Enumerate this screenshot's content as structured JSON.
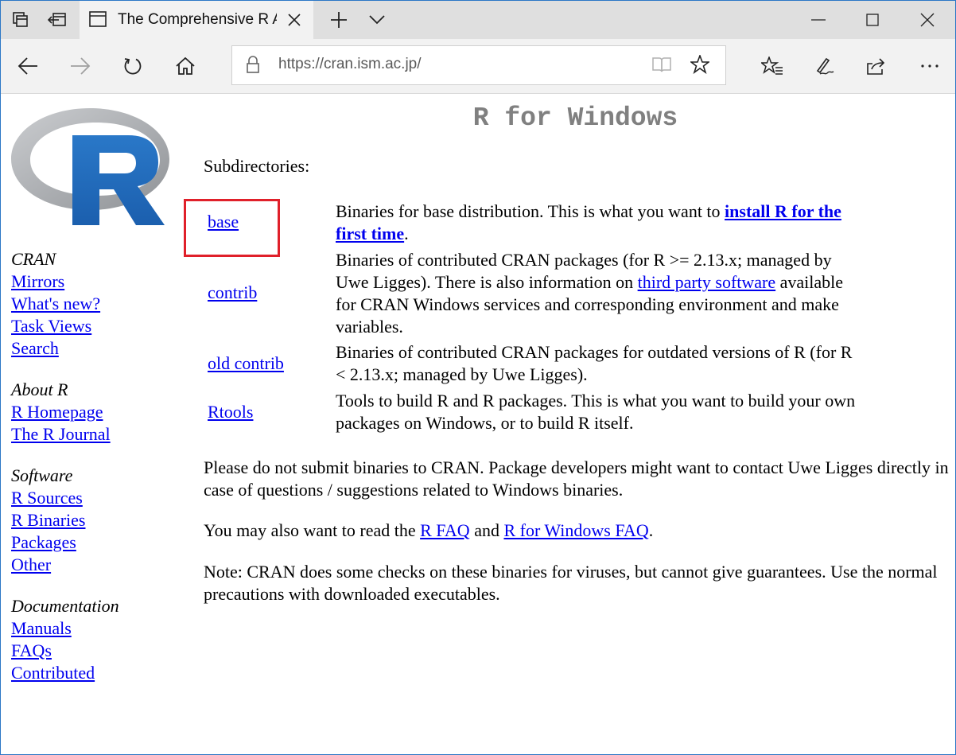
{
  "browser": {
    "tab_title": "The Comprehensive R A",
    "url": "https://cran.ism.ac.jp/",
    "icons": [
      "tab-manager-icon",
      "set-aside-tabs-icon",
      "page-icon",
      "close-icon",
      "new-tab-icon",
      "chevron-down-icon",
      "minimize-icon",
      "maximize-icon",
      "window-close-icon",
      "back-icon",
      "forward-icon",
      "refresh-icon",
      "home-icon",
      "lock-icon",
      "reading-view-icon",
      "favorite-star-icon",
      "favorites-hub-icon",
      "pen-icon",
      "share-icon",
      "more-icon"
    ]
  },
  "logo": {
    "colors": {
      "ring": "#a7a9ad",
      "letter": "#2067b8"
    }
  },
  "sidebar": {
    "groups": [
      {
        "heading": "CRAN",
        "links": [
          "Mirrors",
          "What's new?",
          "Task Views",
          "Search"
        ]
      },
      {
        "heading": "About R",
        "links": [
          "R Homepage",
          "The R Journal"
        ]
      },
      {
        "heading": "Software",
        "links": [
          "R Sources",
          "R Binaries",
          "Packages",
          "Other"
        ]
      },
      {
        "heading": "Documentation",
        "links": [
          "Manuals",
          "FAQs",
          "Contributed"
        ]
      }
    ]
  },
  "main": {
    "title": "R for Windows",
    "subdirectories_label": "Subdirectories:",
    "entries": [
      {
        "link": "base",
        "desc_pre": "Binaries for base distribution. This is what you want to ",
        "desc_link": "install R for the first time",
        "desc_post": "."
      },
      {
        "link": "contrib",
        "desc_pre": "Binaries of contributed CRAN packages (for R >= 2.13.x; managed by Uwe Ligges). There is also information on ",
        "desc_link": "third party software",
        "desc_post": " available for CRAN Windows services and corresponding environment and make variables."
      },
      {
        "link": "old contrib",
        "desc_pre": "Binaries of contributed CRAN packages for outdated versions of R (for R < 2.13.x; managed by Uwe Ligges).",
        "desc_link": "",
        "desc_post": ""
      },
      {
        "link": "Rtools",
        "desc_pre": "Tools to build R and R packages. This is what you want to build your own packages on Windows, or to build R itself.",
        "desc_link": "",
        "desc_post": ""
      }
    ],
    "para1": "Please do not submit binaries to CRAN. Package developers might want to contact Uwe Ligges directly in case of questions / suggestions related to Windows binaries.",
    "para2": {
      "pre": "You may also want to read the ",
      "link1": "R FAQ",
      "mid": " and ",
      "link2": "R for Windows FAQ",
      "post": "."
    },
    "para3": "Note: CRAN does some checks on these binaries for viruses, but cannot give guarantees. Use the normal precautions with downloaded executables.",
    "highlight_color": "#e0202a"
  }
}
